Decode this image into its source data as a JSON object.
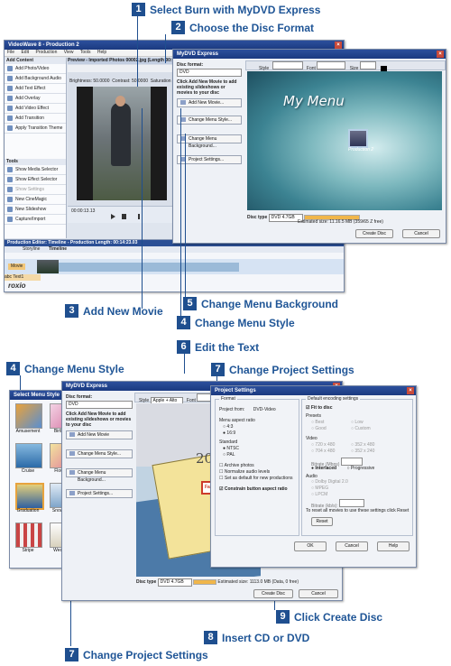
{
  "callouts": {
    "c1": {
      "num": "1",
      "text": "Select Burn with MyDVD Express"
    },
    "c2": {
      "num": "2",
      "text": "Choose the Disc Format"
    },
    "c3": {
      "num": "3",
      "text": "Add New Movie"
    },
    "c4": {
      "num": "4",
      "text": "Change Menu Style"
    },
    "c5": {
      "num": "5",
      "text": "Change Menu Background"
    },
    "c6": {
      "num": "6",
      "text": "Edit the Text"
    },
    "c4b": {
      "num": "4",
      "text": "Change Menu Style"
    },
    "c7": {
      "num": "7",
      "text": "Change Project Settings"
    },
    "c9": {
      "num": "9",
      "text": "Click Create Disc"
    },
    "c8": {
      "num": "8",
      "text": "Insert CD or DVD"
    },
    "c7b": {
      "num": "7",
      "text": "Change Project Settings"
    }
  },
  "videowave": {
    "title": "VideoWave 8 - Production 2",
    "menu": [
      "File",
      "Edit",
      "Production",
      "View",
      "Tools",
      "Help"
    ],
    "add_content_header": "Add Content",
    "add_content": [
      "Add Photo/Video",
      "Add Background Audio",
      "Add Text Effect",
      "Add Overlay",
      "Add Video Effect",
      "Add Transition",
      "Apply Transition Theme"
    ],
    "tools_header": "Tools",
    "tools": [
      "Show Media Selector",
      "Show Effect Selector",
      "Show Settings",
      "New CineMagic Production",
      "New Slideshow",
      "Capture/Import"
    ],
    "preview_title": "Preview - Imported Photos 00002.jpg (Length 00:00:...)",
    "brightness": "Brightness: 50.0000",
    "contrast": "Contrast: 50.0000",
    "saturation": "Saturation",
    "timecode": "00:00:13.13",
    "editor_title": "Production Editor: Timeline - Production Length: 00:14:23.03",
    "storyline_tab": "Storyline",
    "timeline_tab": "Timeline",
    "track_label": "Movie",
    "text_track": "abc Text1",
    "roxio": "roxio"
  },
  "mydvd_top": {
    "title": "MyDVD Express",
    "disc_format_label": "Disc format:",
    "disc_format_value": "DVD",
    "hint": "Click Add New Movie to add existing slideshows or movies to your disc",
    "add_btn": "Add New Movie...",
    "menu_style_btn": "Change Menu Style...",
    "menu_bg_btn": "Change Menu Background...",
    "project_settings_btn": "Project Settings...",
    "menu_title": "My Menu",
    "item_caption": "Production 2",
    "style_label": "Style",
    "font_label": "Font",
    "size_label": "Size",
    "disc_type_label": "Disc type",
    "disc_type_value": "DVD 4.7GB",
    "estimated": "Estimated size: 11.16.5 MB (359/65 Z free)",
    "create_btn": "Create Disc",
    "cancel_btn": "Cancel"
  },
  "select_style": {
    "title": "Select Menu Style",
    "styles": [
      "Amusement",
      "Birthday",
      "Cruise",
      "Flowers",
      "Graduation",
      "Snowman",
      "Stripe",
      "Wedding"
    ]
  },
  "mydvd_bottom": {
    "title": "MyDVD Express",
    "disc_format_label": "Disc format:",
    "disc_format_value": "DVD",
    "hint": "Click Add New Movie to add existing slideshows or movies to your disc",
    "add_btn": "Add New Movie",
    "menu_style_btn": "Change Menu Style...",
    "menu_bg_btn": "Change Menu Background...",
    "project_settings_btn": "Project Settings...",
    "style_label": "Style",
    "style_value": "Apple + Alto",
    "font_label": "Font",
    "year_text": "2005",
    "caption_text": "Fall over",
    "disc_type_label": "Disc type",
    "disc_type_value": "DVD 4.7GB",
    "estimated": "Estimated size: 1113.0 MB (Data, 0 free)",
    "create_btn": "Create Disc",
    "cancel_btn": "Cancel"
  },
  "project_settings": {
    "title": "Project Settings",
    "format_label": "Format",
    "project_from_label": "Project from:",
    "project_from_value": "DVD-Video",
    "aspect_label": "Menu aspect ratio",
    "aspect_opts": [
      "4:3",
      "16:9"
    ],
    "standard_label": "Standard",
    "standard_opts": [
      "NTSC",
      "PAL"
    ],
    "checks": [
      "Archive photos",
      "Normalize audio levels",
      "Set as default for new productions"
    ],
    "constrain": "Constrain button aspect ratio",
    "encoding_label": "Default encoding settings",
    "fit_to_disc": "Fit to disc",
    "presets_label": "Presets",
    "presets": [
      "Best",
      "Low",
      "Good",
      "Custom"
    ],
    "video_label": "Video",
    "video_opts": [
      "720 x 480",
      "352 x 480",
      "704 x 480",
      "352 x 240"
    ],
    "bitrate_label": "Bitrate (Mbps)",
    "interlaced": "Interlaced",
    "progressive": "Progressive",
    "audio_label": "Audio",
    "audio_opts": [
      "Dolby Digital 2.0",
      "MPEG",
      "LPCM"
    ],
    "audio_bitrate_label": "Bitrate (kb/s):",
    "reset_hint": "To reset all movies to use these settings click Reset",
    "reset_btn": "Reset",
    "ok_btn": "OK",
    "cancel_btn": "Cancel",
    "help_btn": "Help"
  }
}
